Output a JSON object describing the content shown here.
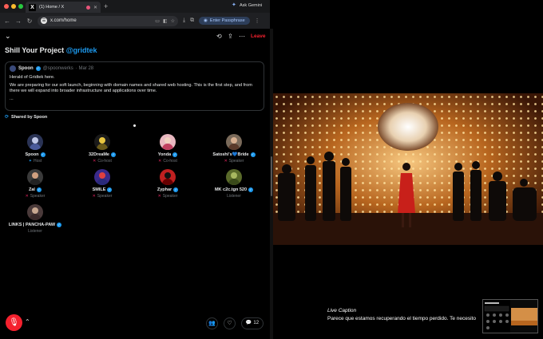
{
  "browser": {
    "tab_title": "(1) Home / X",
    "new_tab": "+",
    "url": "x.com/home",
    "gemini_label": "Ask Gemini",
    "passphrase_label": "Enter Passphrase"
  },
  "space": {
    "title_prefix": "Shill Your Project ",
    "title_handle": "@gridtek",
    "leave_label": "Leave",
    "tweet": {
      "author": "Spoon",
      "handle": "@spoonwerks",
      "date": "· Mar 28",
      "p1": "Herald of Gridtek here.",
      "p2": "We are preparing for our soft launch, beginning with domain names and shared web hosting. This is the first step, and from there we will expand into broader infrastructure and applications over time.",
      "p3": "..."
    },
    "shared_by": "Shared by Spoon",
    "participants": [
      {
        "name": "Spoon",
        "role": "Host"
      },
      {
        "name": "32DreaMe",
        "role": "Co-host"
      },
      {
        "name": "Yonda",
        "role": "Co-host"
      },
      {
        "name": "Satoshi's💙Bride",
        "role": "Speaker"
      },
      {
        "name": "Zal",
        "role": "Speaker"
      },
      {
        "name": "SMILE",
        "role": "Speaker"
      },
      {
        "name": "Zyphar",
        "role": "Speaker"
      },
      {
        "name": "MK c2c.tgn 520",
        "role": "Listener"
      },
      {
        "name": "LINKS | PANCHA-PAW",
        "role": "Listener"
      }
    ],
    "reply_count": "12"
  },
  "video": {
    "caption_title": "Live Caption",
    "caption_text": "Parece que estamos recuperando el tiempo perdido. Te necesito"
  },
  "colors": {
    "accent": "#1d9bf0",
    "leave": "#f4212e",
    "background": "#000000"
  }
}
